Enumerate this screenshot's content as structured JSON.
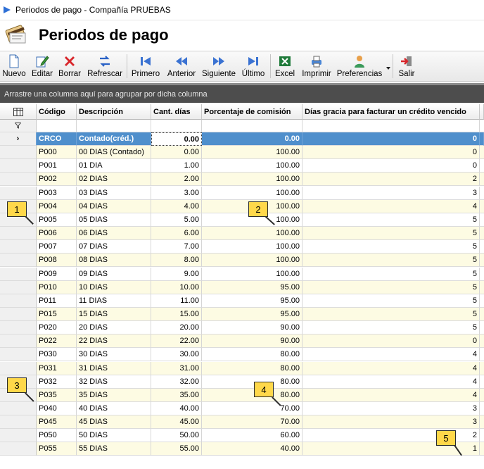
{
  "window": {
    "title": "Periodos de pago - Compañía PRUEBAS"
  },
  "page": {
    "title": "Periodos de pago"
  },
  "toolbar": {
    "nuevo": "Nuevo",
    "editar": "Editar",
    "borrar": "Borrar",
    "refrescar": "Refrescar",
    "primero": "Primero",
    "anterior": "Anterior",
    "siguiente": "Siguiente",
    "ultimo": "Último",
    "excel": "Excel",
    "imprimir": "Imprimir",
    "preferencias": "Preferencias",
    "salir": "Salir"
  },
  "group_panel": {
    "hint": "Arrastre una columna aquí para agrupar por dicha columna"
  },
  "columns": [
    "Código",
    "Descripción",
    "Cant. días",
    "Porcentaje de comisión",
    "Días gracia para facturar un crédito vencido"
  ],
  "rows": [
    [
      "CRCO",
      "Contado(créd.)",
      "0.00",
      "0.00",
      "0"
    ],
    [
      "P000",
      "00 DIAS (Contado)",
      "0.00",
      "100.00",
      "0"
    ],
    [
      "P001",
      "01 DIA",
      "1.00",
      "100.00",
      "0"
    ],
    [
      "P002",
      "02 DIAS",
      "2.00",
      "100.00",
      "2"
    ],
    [
      "P003",
      "03 DIAS",
      "3.00",
      "100.00",
      "3"
    ],
    [
      "P004",
      "04 DIAS",
      "4.00",
      "100.00",
      "4"
    ],
    [
      "P005",
      "05 DIAS",
      "5.00",
      "100.00",
      "5"
    ],
    [
      "P006",
      "06 DIAS",
      "6.00",
      "100.00",
      "5"
    ],
    [
      "P007",
      "07 DIAS",
      "7.00",
      "100.00",
      "5"
    ],
    [
      "P008",
      "08 DIAS",
      "8.00",
      "100.00",
      "5"
    ],
    [
      "P009",
      "09 DIAS",
      "9.00",
      "100.00",
      "5"
    ],
    [
      "P010",
      "10 DIAS",
      "10.00",
      "95.00",
      "5"
    ],
    [
      "P011",
      "11 DIAS",
      "11.00",
      "95.00",
      "5"
    ],
    [
      "P015",
      "15 DIAS",
      "15.00",
      "95.00",
      "5"
    ],
    [
      "P020",
      "20 DIAS",
      "20.00",
      "90.00",
      "5"
    ],
    [
      "P022",
      "22 DIAS",
      "22.00",
      "90.00",
      "0"
    ],
    [
      "P030",
      "30 DIAS",
      "30.00",
      "80.00",
      "4"
    ],
    [
      "P031",
      "31 DIAS",
      "31.00",
      "80.00",
      "4"
    ],
    [
      "P032",
      "32 DIAS",
      "32.00",
      "80.00",
      "4"
    ],
    [
      "P035",
      "35 DIAS",
      "35.00",
      "80.00",
      "4"
    ],
    [
      "P040",
      "40 DIAS",
      "40.00",
      "70.00",
      "3"
    ],
    [
      "P045",
      "45 DIAS",
      "45.00",
      "70.00",
      "3"
    ],
    [
      "P050",
      "50 DIAS",
      "50.00",
      "60.00",
      "2"
    ],
    [
      "P055",
      "55 DIAS",
      "55.00",
      "40.00",
      "1"
    ]
  ],
  "selected_row_marker": "›",
  "callouts": [
    "1",
    "2",
    "3",
    "4",
    "5"
  ],
  "colors": {
    "selected_row": "#4f8fcc",
    "alt_row": "#fdfbe3",
    "group_panel": "#4d4d4d",
    "callout": "#ffd84a"
  }
}
